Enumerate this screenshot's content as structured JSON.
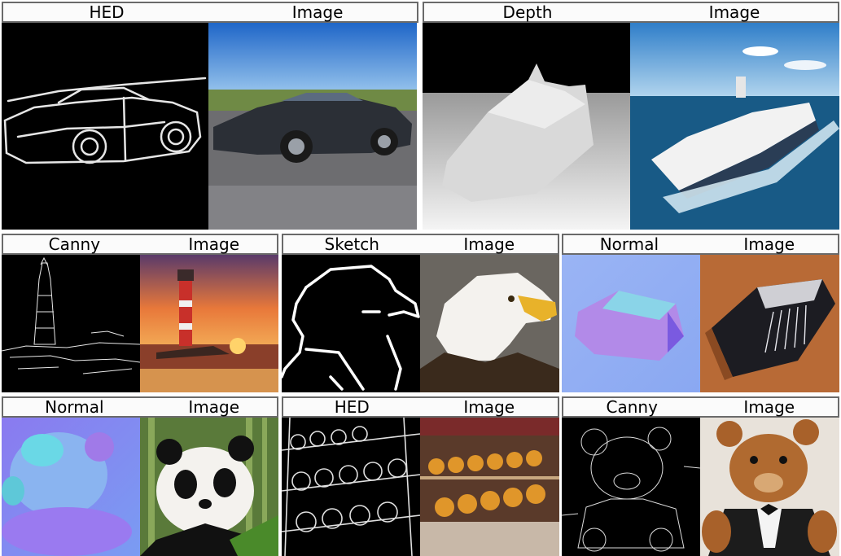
{
  "panels": [
    {
      "condition": "HED",
      "output": "Image",
      "subject": "sports-car"
    },
    {
      "condition": "Depth",
      "output": "Image",
      "subject": "cruise-ship"
    },
    {
      "condition": "Canny",
      "output": "Image",
      "subject": "lighthouse"
    },
    {
      "condition": "Sketch",
      "output": "Image",
      "subject": "eagle"
    },
    {
      "condition": "Normal",
      "output": "Image",
      "subject": "accordion"
    },
    {
      "condition": "Normal",
      "output": "Image",
      "subject": "panda"
    },
    {
      "condition": "HED",
      "output": "Image",
      "subject": "bakery-pastries"
    },
    {
      "condition": "Canny",
      "output": "Image",
      "subject": "teddy-bear"
    }
  ]
}
